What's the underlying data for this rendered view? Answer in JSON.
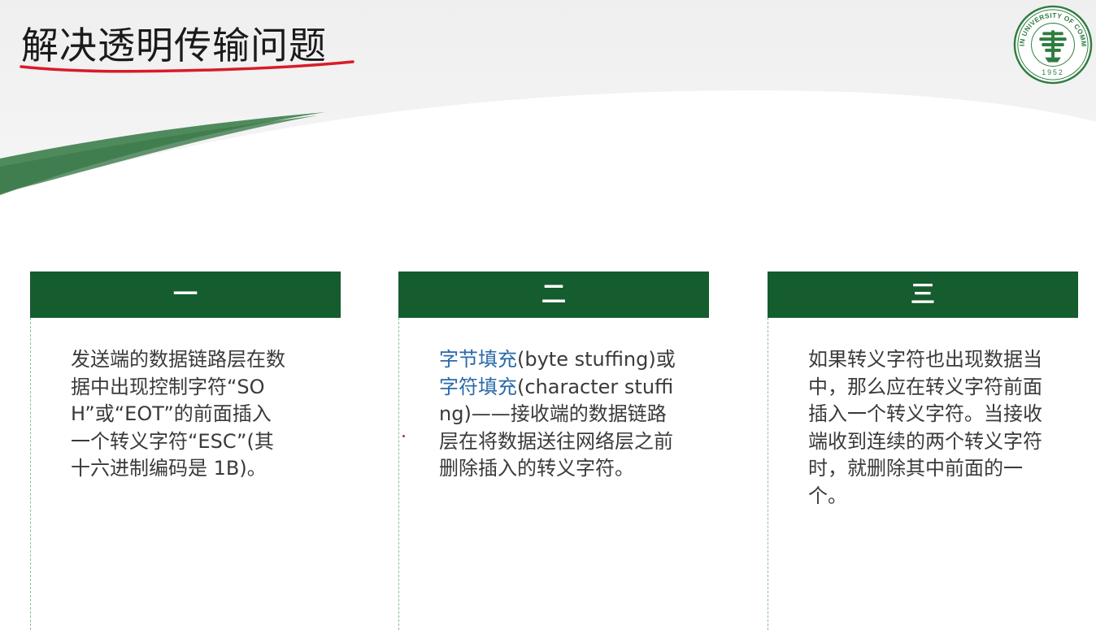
{
  "slide": {
    "title": "解决透明传输问题",
    "logo": {
      "icon": "harbin-university-of-commerce-seal-icon",
      "arc_text": "HARBIN UNIVERSITY OF COMMERCE",
      "year": "1952",
      "color": "#2e7d3f"
    },
    "accent_color": "#155c2e",
    "columns": [
      {
        "header": "一",
        "segments": [
          {
            "text": "发送端的数据链路层在数据中出现控制字符“SOH”或“EOT”的前面插入一个转义字符“ESC”(其十六进制编码是 1B)。",
            "highlight": false
          }
        ]
      },
      {
        "header": "二",
        "segments": [
          {
            "text": "字节填充",
            "highlight": true
          },
          {
            "text": "(byte stuffing)或",
            "highlight": false
          },
          {
            "text": "字符填充",
            "highlight": true
          },
          {
            "text": "(character stuffing)——接收端的数据链路层在将数据送往网络层之前删除插入的转义字符。",
            "highlight": false
          }
        ]
      },
      {
        "header": "三",
        "segments": [
          {
            "text": "如果转义字符也出现数据当中，那么应在转义字符前面插入一个转义字符。当接收端收到连续的两个转义字符时，就删除其中前面的一个。",
            "highlight": false
          }
        ]
      }
    ]
  }
}
